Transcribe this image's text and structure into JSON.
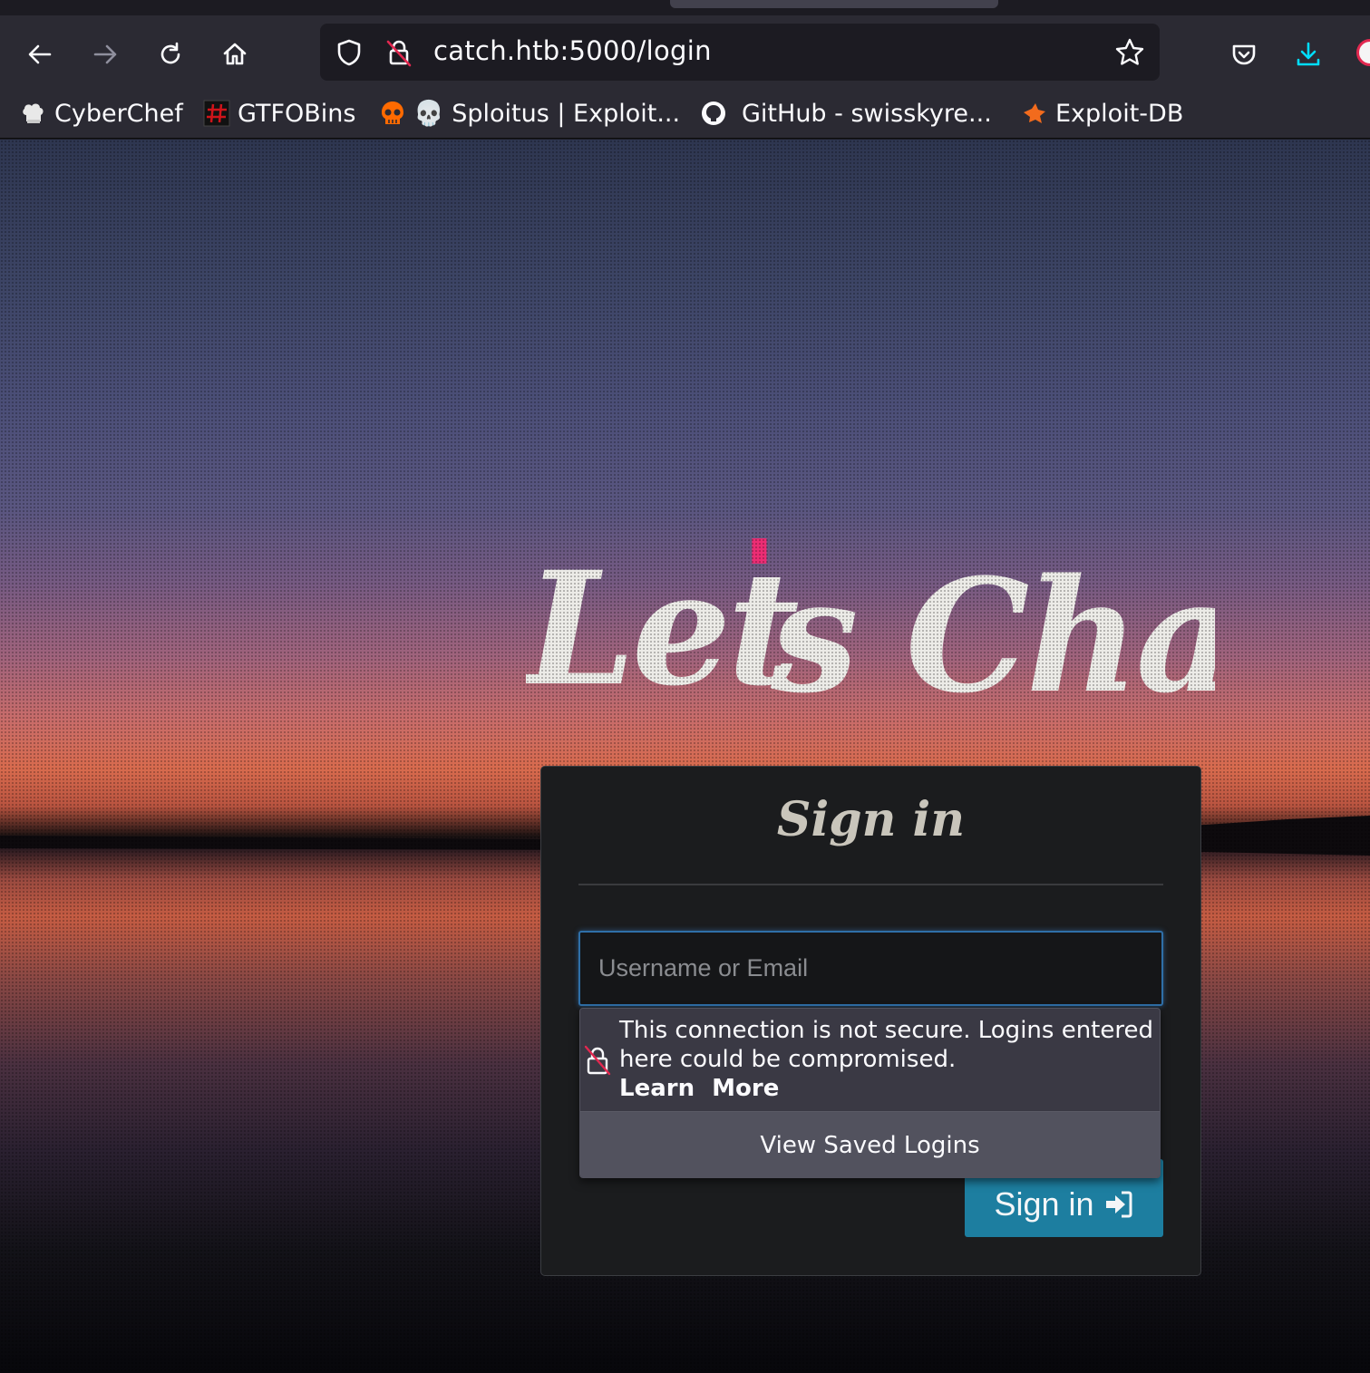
{
  "browser": {
    "url": "catch.htb:5000/login",
    "bookmarks": [
      {
        "label": "CyberChef",
        "icon": "chef-hat-icon"
      },
      {
        "label": "GTFOBins",
        "icon": "gtfobins-icon"
      },
      {
        "label": "💀 Sploitus | Exploit...",
        "icon": "skull-icon"
      },
      {
        "label": "GitHub - swisskyre...",
        "icon": "github-icon"
      },
      {
        "label": "Exploit-DB",
        "icon": "exploit-db-icon"
      }
    ],
    "colors": {
      "chrome": "#2b2a33",
      "urlbar": "#1c1b22",
      "download_accent": "#00ddff"
    }
  },
  "page": {
    "logo_text_main": "Let",
    "logo_apostrophe": "'",
    "logo_text_rest": "s Chat",
    "logo_accent_color": "#ec2d74",
    "signin": {
      "title": "Sign in",
      "username_placeholder": "Username or Email",
      "button_label": "Sign in",
      "button_color": "#1d7ea0"
    },
    "insecure_popup": {
      "message": "This connection is not secure. Logins entered here could be compromised.",
      "learn_more": "Learn More",
      "view_saved": "View Saved Logins"
    }
  }
}
